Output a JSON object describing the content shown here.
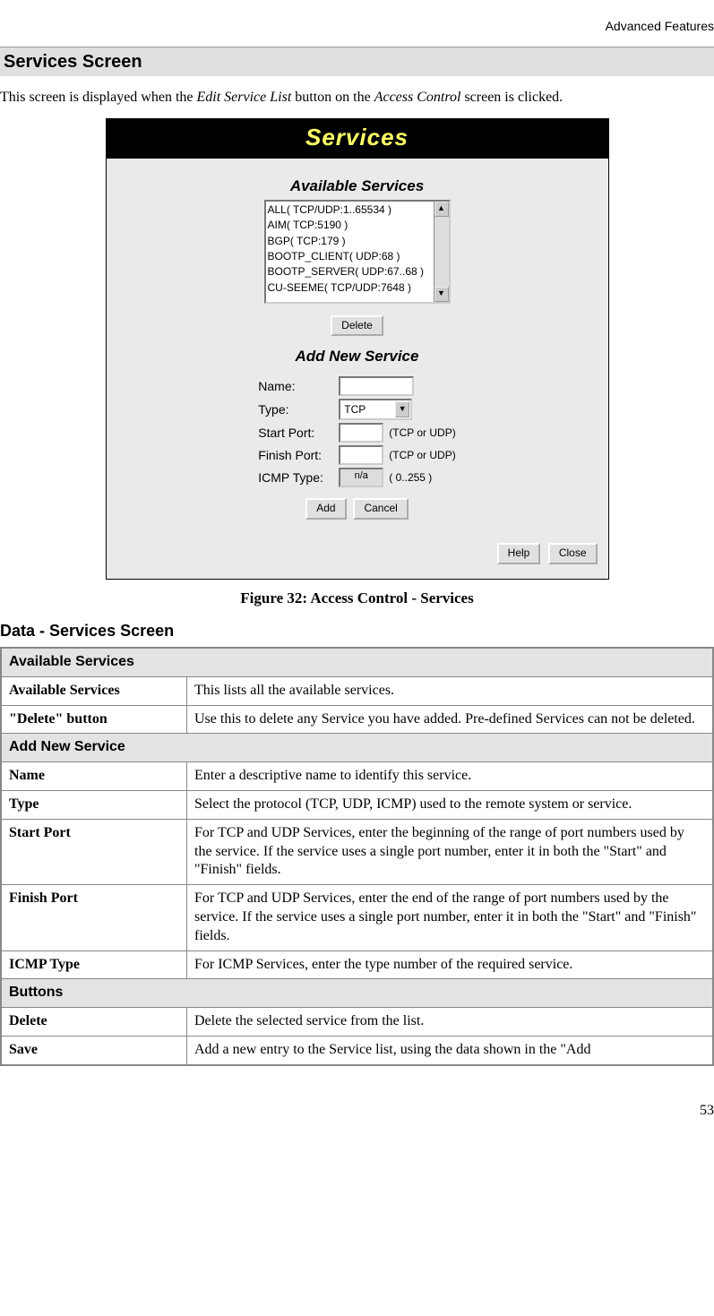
{
  "header_text": "Advanced Features",
  "section_title": "Services Screen",
  "intro": {
    "pre": "This screen is displayed when the ",
    "em1": "Edit Service List",
    "mid": " button on the ",
    "em2": "Access Control",
    "post": " screen is clicked."
  },
  "dialog": {
    "title": "Services",
    "avail_label": "Available Services",
    "services": [
      "ALL( TCP/UDP:1..65534 )",
      "AIM( TCP:5190 )",
      "BGP( TCP:179 )",
      "BOOTP_CLIENT( UDP:68 )",
      "BOOTP_SERVER( UDP:67..68 )",
      "CU-SEEME( TCP/UDP:7648 )"
    ],
    "delete_btn": "Delete",
    "add_new_label": "Add New Service",
    "form": {
      "name_label": "Name:",
      "type_label": "Type:",
      "type_value": "TCP",
      "start_label": "Start Port:",
      "finish_label": "Finish Port:",
      "tcpudp_hint": "(TCP or UDP)",
      "icmp_label": "ICMP Type:",
      "icmp_value": "n/a",
      "icmp_hint": "( 0..255 )"
    },
    "add_btn": "Add",
    "cancel_btn": "Cancel",
    "help_btn": "Help",
    "close_btn": "Close"
  },
  "caption": "Figure 32: Access Control - Services",
  "data_heading": "Data - Services Screen",
  "table": {
    "group1": "Available Services",
    "r1_label": "Available Services",
    "r1_desc": "This lists all the available services.",
    "r2_label": "\"Delete\" button",
    "r2_desc": "Use this to delete any Service you have added. Pre-defined Services can not be deleted.",
    "group2": "Add New Service",
    "r3_label": "Name",
    "r3_desc": "Enter a descriptive name to identify this service.",
    "r4_label": "Type",
    "r4_desc": "Select the protocol (TCP, UDP, ICMP) used to the remote system or service.",
    "r5_label": "Start Port",
    "r5_desc": "For TCP and UDP Services, enter the beginning of the range of port numbers used by the service. If the service uses a single port number, enter it in both the \"Start\" and \"Finish\" fields.",
    "r6_label": "Finish Port",
    "r6_desc": "For TCP and UDP Services, enter the end of the range of port numbers used by the service. If the service uses a single port number, enter it in both the \"Start\" and \"Finish\" fields.",
    "r7_label": "ICMP Type",
    "r7_desc": "For ICMP Services, enter the type number of the required service.",
    "group3": "Buttons",
    "r8_label": "Delete",
    "r8_desc": "Delete the selected service from the list.",
    "r9_label": "Save",
    "r9_desc": "Add a new entry to the Service list, using the data shown in the \"Add"
  },
  "page_number": "53"
}
